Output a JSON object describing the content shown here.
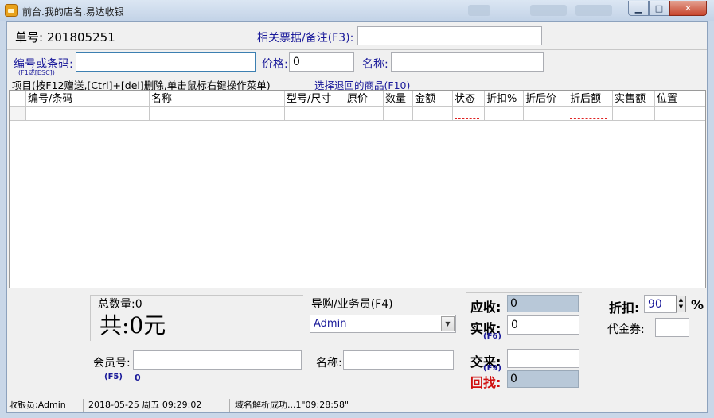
{
  "window": {
    "title": "前台.我的店名.易达收银",
    "ghost1": "",
    "ghost2": ""
  },
  "order": {
    "label": "单号:",
    "value": "201805251"
  },
  "notes": {
    "label": "相关票据/备注(F3):",
    "value": ""
  },
  "code": {
    "label": "编号或条码:",
    "hint": "(F1或[ESC])",
    "value": ""
  },
  "price": {
    "label": "价格:",
    "value": "0"
  },
  "name": {
    "label": "名称:",
    "value": ""
  },
  "items_bar": {
    "text": "项目(按F12赠送,[Ctrl]+[del]删除,单击鼠标右键操作菜单)",
    "link": "选择退回的商品(F10)"
  },
  "table": {
    "columns": [
      "编号/条码",
      "名称",
      "型号/尺寸",
      "原价",
      "数量",
      "金额",
      "状态",
      "折扣%",
      "折后价",
      "折后额",
      "实售额",
      "位置"
    ]
  },
  "summary": {
    "count_label": "总数量:0",
    "total": "共:0元"
  },
  "salesperson": {
    "label": "导购/业务员(F4)",
    "selected": "Admin"
  },
  "member": {
    "label": "会员号:",
    "value": "",
    "hotkey": "(F5)",
    "points": "0",
    "name_label": "名称:",
    "name_value": ""
  },
  "payment": {
    "receivable_label": "应收:",
    "receivable": "0",
    "paid_label": "实收:",
    "paid_hotkey": "(F6)",
    "paid": "0",
    "tendered_label": "交来:",
    "tendered_hotkey": "(F9)",
    "tendered": "",
    "change_label": "回找:",
    "change": "0"
  },
  "discount": {
    "label": "折扣:",
    "value": "90",
    "unit": "%",
    "voucher_label": "代金券:",
    "voucher": ""
  },
  "status": {
    "cashier": "收银员:Admin",
    "datetime": "2018-05-25 周五 09:29:02",
    "message": "域名解析成功...1\"09:28:58\""
  }
}
